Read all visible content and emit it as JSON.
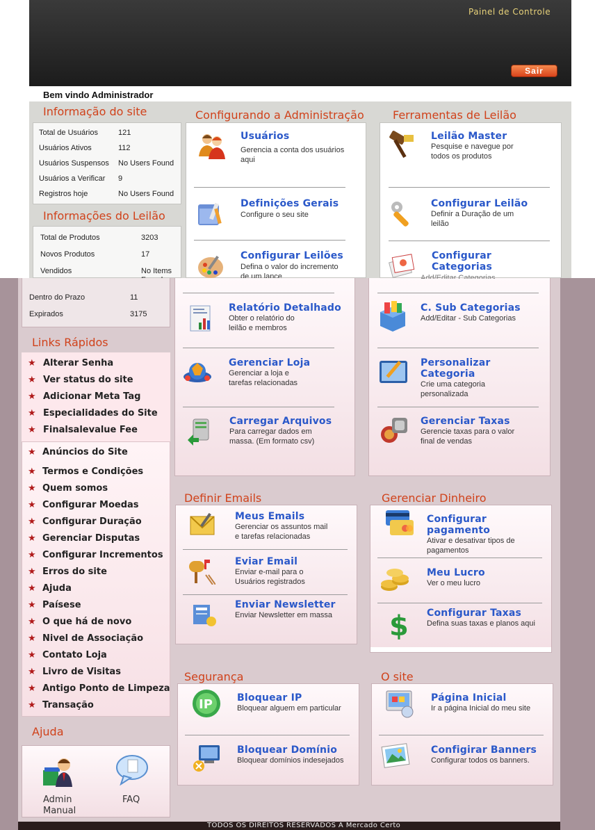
{
  "header": {
    "panel_link": "Painel de Controle",
    "logout_label": "Sair",
    "welcome": "Bem vindo Administrador"
  },
  "site_info": {
    "title": "Informação do site",
    "rows": [
      {
        "label": "Total de Usuários",
        "value": "121"
      },
      {
        "label": "Usuários Ativos",
        "value": "112"
      },
      {
        "label": "Usuários Suspensos",
        "value": "No Users Found"
      },
      {
        "label": "Usuários a Verificar",
        "value": "9"
      },
      {
        "label": "Registros hoje",
        "value": "No Users Found"
      }
    ]
  },
  "auction_info": {
    "title": "Informações do Leilão",
    "rows": [
      {
        "label": "Total de Produtos",
        "value": "3203"
      },
      {
        "label": "Novos Produtos",
        "value": "17"
      },
      {
        "label": "Vendidos",
        "value": "No Items Found"
      },
      {
        "label": "Dentro do Prazo",
        "value": "11"
      },
      {
        "label": "Expirados",
        "value": "3175"
      }
    ]
  },
  "admin_config": {
    "title": "Configurando a Administração",
    "items": [
      {
        "title": "Usuários",
        "desc": "Gerencia a conta dos usuários aqui"
      },
      {
        "title": "Definições Gerais",
        "desc": "Configure o seu site"
      },
      {
        "title": "Configurar Leilões",
        "desc": "Defina o valor do incremento de um lance"
      },
      {
        "title": "Relatório Detalhado",
        "desc": "Obter o relatório do leilão e membros"
      },
      {
        "title": "Gerenciar Loja",
        "desc": "Gerenciar a loja e tarefas relacionadas"
      },
      {
        "title": "Carregar Arquivos",
        "desc": "Para carregar dados em massa. (Em formato csv)"
      }
    ]
  },
  "auction_tools": {
    "title": "Ferramentas de Leilão",
    "items": [
      {
        "title": "Leilão Master",
        "desc": "Pesquise e navegue por todos os produtos"
      },
      {
        "title": "Configurar Leilão",
        "desc": "Definir a Duração de um leilão"
      },
      {
        "title": "Configurar Categorias",
        "desc": "Add/Editar Categorias"
      },
      {
        "title": "C. Sub Categorias",
        "desc": "Add/Editar - Sub Categorias"
      },
      {
        "title": "Personalizar Categoria",
        "desc": "Crie uma categoria personalizada"
      },
      {
        "title": "Gerenciar Taxas",
        "desc": "Gerencie taxas para o valor final de vendas"
      }
    ]
  },
  "quick_links": {
    "title": "Links Rápidos",
    "items": [
      "Alterar Senha",
      "Ver status do site",
      "Adicionar Meta Tag",
      "Especialidades do Site",
      "Finalsalevalue Fee",
      "Anúncios do Site",
      "Termos e Condições",
      "Quem somos",
      "Configurar Moedas",
      "Configurar Duração",
      "Gerenciar Disputas",
      "Configurar Incrementos",
      "Erros do site",
      "Ajuda",
      "Paísese",
      "O que há de novo",
      "Nivel de Associação",
      "Contato Loja",
      "Livro de Visitas",
      "Antigo Ponto de Limpeza",
      "Transação"
    ]
  },
  "help": {
    "title": "Ajuda",
    "admin_manual": "Admin Manual",
    "faq": "FAQ"
  },
  "emails": {
    "title": "Definir Emails",
    "items": [
      {
        "title": "Meus Emails",
        "desc": "Gerenciar os assuntos mail e tarefas relacionadas"
      },
      {
        "title": "Eviar Email",
        "desc": "Enviar e-mail para o Usuários registrados"
      },
      {
        "title": "Enviar Newsletter",
        "desc": "Enviar Newsletter em massa"
      }
    ]
  },
  "money": {
    "title": "Gerenciar Dinheiro",
    "items": [
      {
        "title": "Configurar pagamento",
        "desc": "Ativar e desativar tipos de pagamentos"
      },
      {
        "title": "Meu Lucro",
        "desc": "Ver o meu lucro"
      },
      {
        "title": "Configurar Taxas",
        "desc": "Defina suas taxas e planos aqui"
      }
    ]
  },
  "security": {
    "title": "Segurança",
    "items": [
      {
        "title": "Bloquear IP",
        "desc": "Bloquear alguem em particular"
      },
      {
        "title": "Bloquear Domínio",
        "desc": "Bloquear domínios indesejados"
      }
    ]
  },
  "site": {
    "title": "O site",
    "items": [
      {
        "title": "Página Inicial",
        "desc": "Ir a página Inicial do meu site"
      },
      {
        "title": "Configirar Banners",
        "desc": "Configurar todos os banners."
      }
    ]
  },
  "footer": {
    "text": "TODOS OS DIREITOS RESERVADOS A Mercado Certo"
  },
  "colors": {
    "section_title": "#d0421b",
    "tool_title": "#2a58c9",
    "header_bg": "#1c1c1c",
    "logout_btn": "#e05a2a"
  }
}
